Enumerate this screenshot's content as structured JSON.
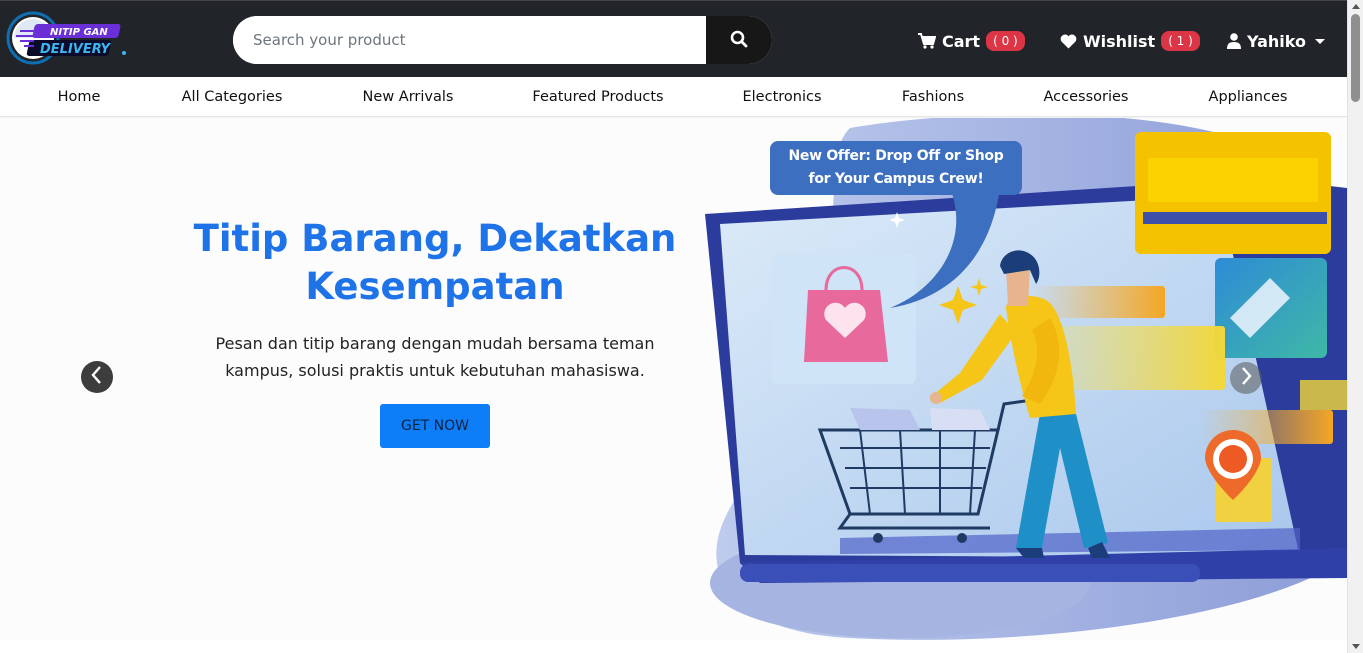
{
  "header": {
    "logo_text_top": "NITIP GAN",
    "logo_text_bottom": "DELIVERY",
    "search_placeholder": "Search your product",
    "cart_label": "Cart",
    "cart_count": "( 0 )",
    "wishlist_label": "Wishlist",
    "wishlist_count": "( 1 )",
    "user_name": "Yahiko"
  },
  "categories": [
    {
      "label": "Home"
    },
    {
      "label": "All Categories"
    },
    {
      "label": "New Arrivals"
    },
    {
      "label": "Featured Products"
    },
    {
      "label": "Electronics"
    },
    {
      "label": "Fashions"
    },
    {
      "label": "Accessories"
    },
    {
      "label": "Appliances"
    }
  ],
  "hero": {
    "title": "Titip Barang, Dekatkan Kesempatan",
    "description": "Pesan dan titip barang dengan mudah bersama teman kampus, solusi praktis untuk kebutuhan mahasiswa.",
    "button_label": "GET NOW",
    "offer_line1": "New Offer: Drop Off or Shop",
    "offer_line2": "for Your Campus Crew!"
  },
  "icons": {
    "search": "search-icon",
    "cart": "cart-icon",
    "wishlist": "heart-icon",
    "user": "user-icon",
    "prev": "chevron-left-icon",
    "next": "chevron-right-icon"
  },
  "colors": {
    "header_bg": "#212529",
    "accent_blue": "#1e73e8",
    "button_blue": "#0d7ef7",
    "badge_red": "#dc3545"
  }
}
